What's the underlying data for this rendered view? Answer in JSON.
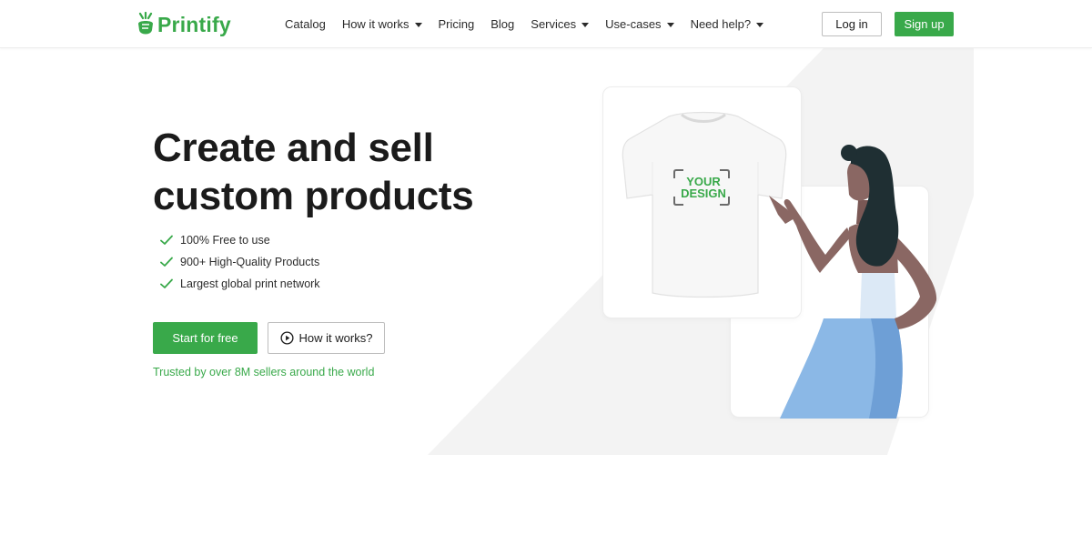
{
  "brand": {
    "name": "Printify",
    "accent_color": "#39a94a"
  },
  "header": {
    "nav": [
      {
        "label": "Catalog",
        "dropdown": false
      },
      {
        "label": "How it works",
        "dropdown": true
      },
      {
        "label": "Pricing",
        "dropdown": false
      },
      {
        "label": "Blog",
        "dropdown": false
      },
      {
        "label": "Services",
        "dropdown": true
      },
      {
        "label": "Use-cases",
        "dropdown": true
      },
      {
        "label": "Need help?",
        "dropdown": true
      }
    ],
    "login_label": "Log in",
    "signup_label": "Sign up"
  },
  "hero": {
    "title_line1": "Create and sell",
    "title_line2": "custom products",
    "features": [
      "100% Free to use",
      "900+ High-Quality Products",
      "Largest global print network"
    ],
    "cta_primary": "Start for free",
    "cta_secondary": "How it works?",
    "trusted_text": "Trusted by over 8M sellers around the world"
  },
  "illustration": {
    "design_line1": "YOUR",
    "design_line2": "DESIGN",
    "icons": [
      "check-icon",
      "play-circle-icon",
      "printify-logo-icon",
      "chevron-down-icon"
    ]
  }
}
